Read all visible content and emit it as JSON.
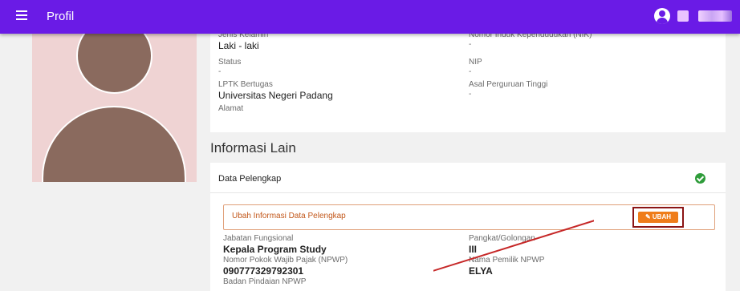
{
  "topbar": {
    "title": "Profil"
  },
  "profile_fields": {
    "jenis_kelamin": {
      "label": "Jenis Kelamin",
      "value": "Laki - laki"
    },
    "nik": {
      "label": "Nomor Induk Kependudukan (NIK)",
      "value": "-"
    },
    "status": {
      "label": "Status",
      "value": "-"
    },
    "nip": {
      "label": "NIP",
      "value": "-"
    },
    "lptk": {
      "label": "LPTK Bertugas",
      "value": "Universitas Negeri Padang"
    },
    "asal_pt": {
      "label": "Asal Perguruan Tinggi",
      "value": "-"
    },
    "alamat": {
      "label": "Alamat"
    }
  },
  "section": {
    "title": "Informasi Lain"
  },
  "data_pelengkap": {
    "title": "Data Pelengkap",
    "edit_prompt": "Ubah Informasi Data Pelengkap",
    "edit_button": "UBAH",
    "fields": {
      "jabatan": {
        "label": "Jabatan Fungsional",
        "value": "Kepala Program Study"
      },
      "pangkat": {
        "label": "Pangkat/Golongan",
        "value": "III"
      },
      "npwp": {
        "label": "Nomor Pokok Wajib Pajak (NPWP)",
        "value": "090777329792301"
      },
      "pemilik_npwp": {
        "label": "Nama Pemilik NPWP",
        "value": "ELYA"
      }
    },
    "partial_label": "Badan Pindaian NPWP"
  },
  "colors": {
    "topbar": "#6a1be6",
    "accent": "#ef7d1a",
    "highlight": "#8b1414",
    "success": "#2e9c3a"
  }
}
